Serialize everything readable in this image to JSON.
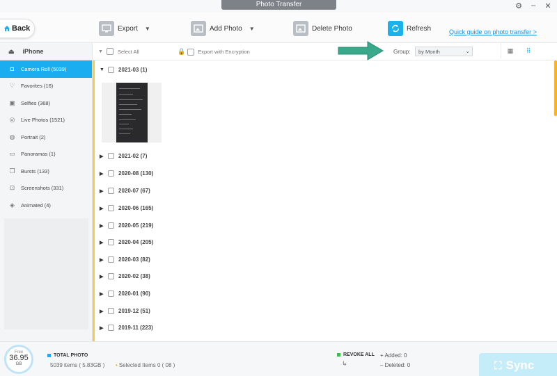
{
  "window": {
    "title": "Photo Transfer"
  },
  "toolbar": {
    "back_label": "Back",
    "export_label": "Export",
    "add_photo_label": "Add Photo",
    "delete_photo_label": "Delete Photo",
    "refresh_label": "Refresh",
    "guide_link": "Quick guide on photo transfer >"
  },
  "sidebar": {
    "device": "iPhone",
    "items": [
      {
        "label": "Camera Roll (5039)",
        "icon": "camera-icon"
      },
      {
        "label": "Favorites (16)",
        "icon": "heart-icon"
      },
      {
        "label": "Selfies (368)",
        "icon": "person-icon"
      },
      {
        "label": "Live Photos (1521)",
        "icon": "live-photo-icon"
      },
      {
        "label": "Portrait (2)",
        "icon": "portrait-icon"
      },
      {
        "label": "Panoramas (1)",
        "icon": "panorama-icon"
      },
      {
        "label": "Bursts (133)",
        "icon": "bursts-icon"
      },
      {
        "label": "Screenshots (331)",
        "icon": "screenshot-icon"
      },
      {
        "label": "Animated (4)",
        "icon": "animated-icon"
      }
    ]
  },
  "filter": {
    "select_all": "Select All",
    "export_encryption": "Export with Encryption",
    "group_label": "Group:",
    "group_value": "by Month"
  },
  "months": [
    {
      "label": "2021-03",
      "count": "(1)",
      "expanded": true
    },
    {
      "label": "2021-02",
      "count": "(7)"
    },
    {
      "label": "2020-08",
      "count": "(130)"
    },
    {
      "label": "2020-07",
      "count": "(67)"
    },
    {
      "label": "2020-06",
      "count": "(165)"
    },
    {
      "label": "2020-05",
      "count": "(219)"
    },
    {
      "label": "2020-04",
      "count": "(205)"
    },
    {
      "label": "2020-03",
      "count": "(82)"
    },
    {
      "label": "2020-02",
      "count": "(38)"
    },
    {
      "label": "2020-01",
      "count": "(90)"
    },
    {
      "label": "2019-12",
      "count": "(51)"
    },
    {
      "label": "2019-11",
      "count": "(223)"
    }
  ],
  "status": {
    "free_label": "Free",
    "free_value": "36.95",
    "free_unit": "GB",
    "total_title": "TOTAL PHOTO",
    "total_items": "5039 items ( 5.83GB )",
    "selected_items": "Selected Items 0 ( 08 )",
    "revoke_all": "REVOKE ALL",
    "added": "Added: 0",
    "deleted": "Deleted: 0",
    "sync_label": "Sync"
  },
  "colors": {
    "accent": "#1aaef0",
    "highlight_bar": "#f9c84e",
    "callout_arrow": "#3aa88a"
  }
}
